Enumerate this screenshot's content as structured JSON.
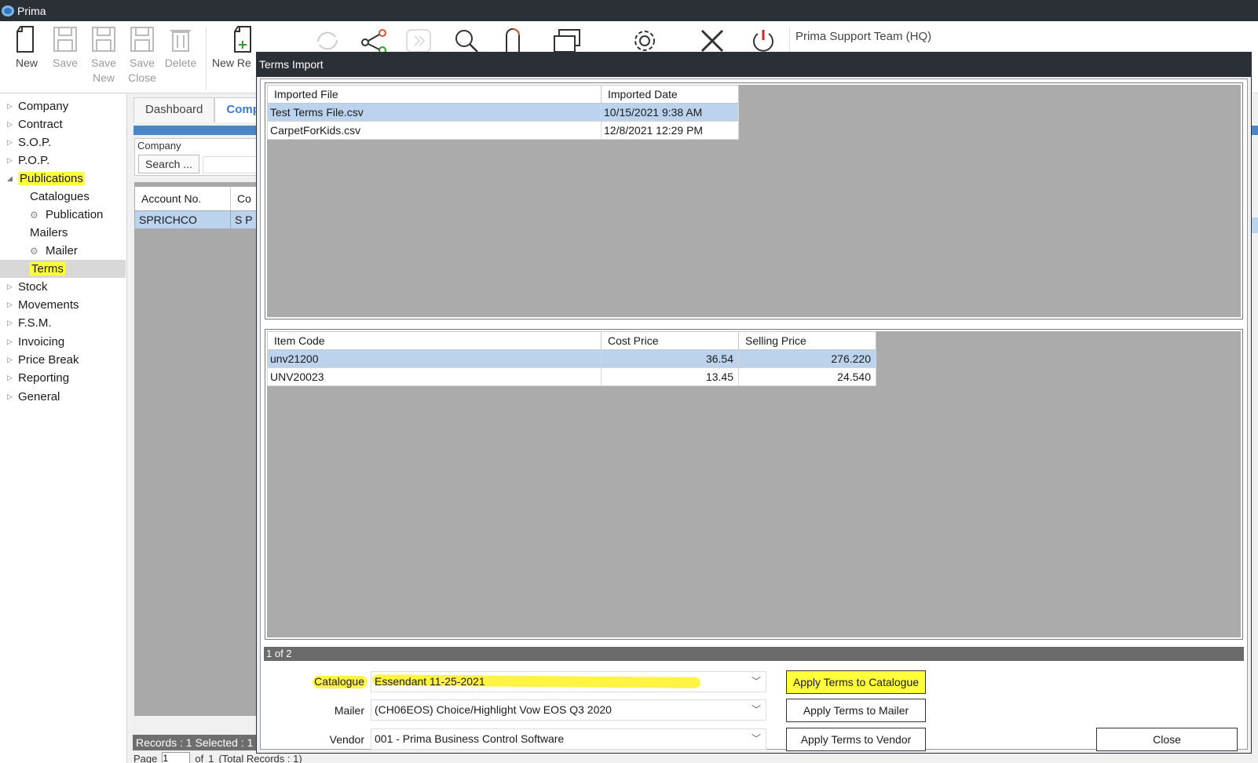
{
  "window": {
    "title": "Prima"
  },
  "toolbar": {
    "new": "New",
    "save": "Save",
    "save_new": [
      "Save",
      "New"
    ],
    "save_close": [
      "Save",
      "Close"
    ],
    "delete": "Delete",
    "new_re": "New Re",
    "user": "Prima Support Team  (HQ)"
  },
  "nav": {
    "items": [
      {
        "label": "Company",
        "arrow": "▷"
      },
      {
        "label": "Contract",
        "arrow": "▷"
      },
      {
        "label": "S.O.P.",
        "arrow": "▷"
      },
      {
        "label": "P.O.P.",
        "arrow": "▷"
      },
      {
        "label": "Publications",
        "arrow": "◢"
      },
      {
        "label": "Catalogues"
      },
      {
        "label": "Publication",
        "icon": "gear-icon"
      },
      {
        "label": "Mailers"
      },
      {
        "label": "Mailer",
        "icon": "gear-icon"
      },
      {
        "label": "Terms"
      },
      {
        "label": "Stock",
        "arrow": "▷"
      },
      {
        "label": "Movements",
        "arrow": "▷"
      },
      {
        "label": "F.S.M.",
        "arrow": "▷"
      },
      {
        "label": "Invoicing",
        "arrow": "▷"
      },
      {
        "label": "Price Break",
        "arrow": "▷"
      },
      {
        "label": "Reporting",
        "arrow": "▷"
      },
      {
        "label": "General",
        "arrow": "▷"
      }
    ]
  },
  "main": {
    "tabs": [
      "Dashboard",
      "Compa"
    ],
    "company_caption": "Company",
    "search_button": "Search ...",
    "grid_headers": [
      "Account No.",
      "Co"
    ],
    "grid_row": [
      "SPRICHCO",
      "S P"
    ],
    "records": "Records : 1   Selected : 1",
    "pager": {
      "page_label": "Page",
      "page_value": "1",
      "of": "of",
      "total": "1",
      "total_records": "(Total Records : 1)"
    }
  },
  "dialog": {
    "title": "Terms Import",
    "files_grid": {
      "headers": [
        "Imported File",
        "Imported Date"
      ],
      "rows": [
        [
          "Test Terms File.csv",
          "10/15/2021 9:38 AM"
        ],
        [
          "CarpetForKids.csv",
          "12/8/2021 12:29 PM"
        ]
      ]
    },
    "items_grid": {
      "headers": [
        "Item Code",
        "Cost Price",
        "Selling Price"
      ],
      "rows": [
        [
          "unv21200",
          "36.54",
          "276.220"
        ],
        [
          "UNV20023",
          "13.45",
          "24.540"
        ]
      ]
    },
    "page_indicator": "1 of 2",
    "catalogue_label": "Catalogue",
    "catalogue_value": "Essendant 11-25-2021",
    "mailer_label": "Mailer",
    "mailer_value": "(CH06EOS) Choice/Highlight Vow EOS Q3 2020",
    "vendor_label": "Vendor",
    "vendor_value": "001 - Prima Business Control Software",
    "apply_catalogue": "Apply Terms to Catalogue",
    "apply_mailer": "Apply Terms to Mailer",
    "apply_vendor": "Apply Terms to Vendor",
    "close": "Close"
  },
  "colors": {
    "titlebar": "#2b2f36",
    "highlight": "#ffff3a",
    "selection": "#bcd3ee",
    "grid_bg": "#ababab"
  }
}
